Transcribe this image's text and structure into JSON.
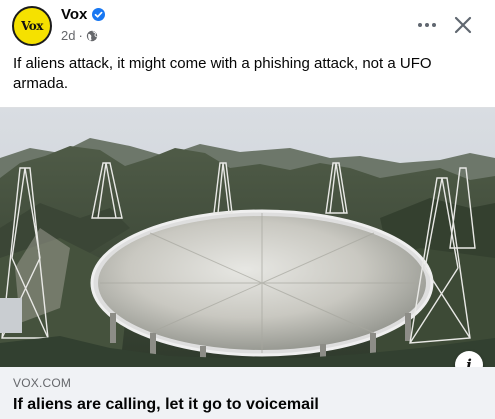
{
  "post": {
    "page_name": "Vox",
    "avatar_text": "Vox",
    "verified": true,
    "time": "2d",
    "separator": "·",
    "privacy_icon": "globe-icon",
    "message": "If aliens attack, it might come with a phishing attack, not a UFO armada."
  },
  "actions": {
    "more_icon": "more-horizontal-icon",
    "close_icon": "close-icon"
  },
  "link_preview": {
    "image_subject": "Giant radio telescope dish surrounded by mountains",
    "info_label": "i",
    "domain": "VOX.COM",
    "title": "If aliens are calling, let it go to voicemail"
  },
  "colors": {
    "brand_yellow": "#f5e100",
    "verified_blue": "#1877f2",
    "secondary_text": "#65676b",
    "link_bar_bg": "#f0f2f5"
  }
}
